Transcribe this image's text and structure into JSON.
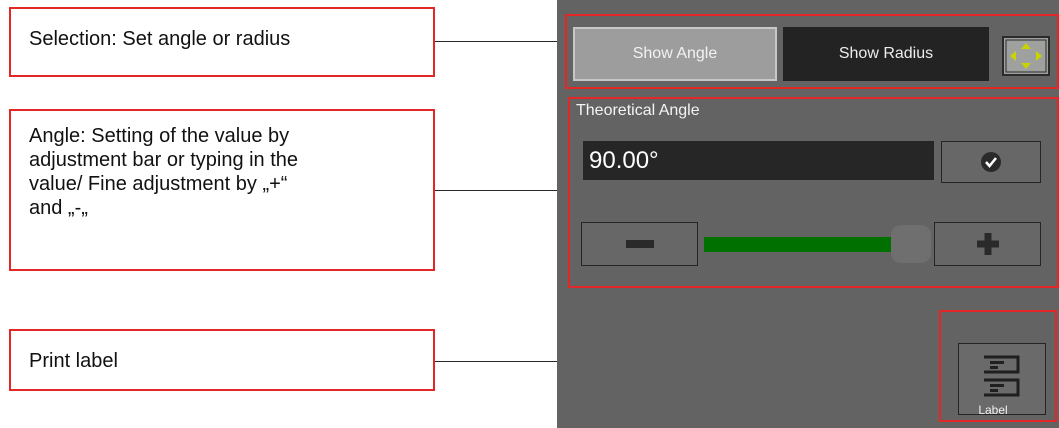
{
  "callouts": {
    "selection": "Selection: Set angle or radius",
    "angle_line1": "Angle: Setting of the value by",
    "angle_line2": "adjustment bar or typing in the",
    "angle_line3": "value/ Fine adjustment by „+“",
    "angle_line4": "and „-„",
    "print": "Print label"
  },
  "panel": {
    "show_angle_label": "Show Angle",
    "show_radius_label": "Show Radius",
    "fit_icon": "four-arrows-expand-icon",
    "section_title": "Theoretical Angle",
    "angle_value": "90.00°",
    "confirm_icon": "checkmark-circle-icon",
    "minus_icon": "minus-icon",
    "plus_icon": "plus-icon",
    "slider_level": 0.95,
    "label_icon": "label-document-icon",
    "label_text": "Label"
  },
  "colors": {
    "callout_border": "#e32626",
    "panel_background": "#646364",
    "slider_fill": "#007000",
    "fit_arrows": "#c8d400"
  }
}
